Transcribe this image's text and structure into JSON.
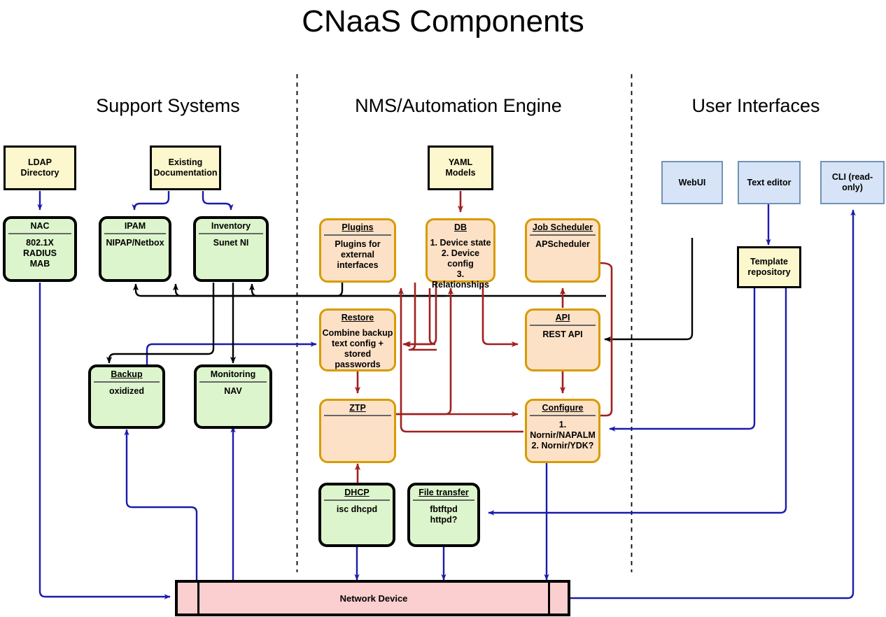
{
  "title": "CNaaS Components",
  "sections": [
    {
      "label": "Support Systems"
    },
    {
      "label": "NMS/Automation Engine"
    },
    {
      "label": "User Interfaces"
    }
  ],
  "colors": {
    "yellow_fill": "#fdf7cd",
    "green_fill": "#ddf5cc",
    "orange_fill": "#fde1c6",
    "orange_stroke": "#d79b00",
    "blue_fill": "#d7e4f7",
    "blue_stroke": "#7392b5",
    "pink_fill": "#fbcfcf",
    "arrow_blue": "#1a1aad",
    "arrow_red": "#a02020",
    "arrow_black": "#000000"
  },
  "nodes": {
    "ldap": {
      "header": "LDAP\nDirectory",
      "body": ""
    },
    "existing_docs": {
      "header": "Existing\nDocumentation",
      "body": ""
    },
    "nac": {
      "header": "NAC",
      "body": "802.1X\nRADIUS\nMAB"
    },
    "ipam": {
      "header": "IPAM",
      "body": "NIPAP/Netbox"
    },
    "inventory": {
      "header": "Inventory",
      "body": "Sunet NI"
    },
    "backup": {
      "header": "Backup",
      "body": "oxidized"
    },
    "monitoring": {
      "header": "Monitoring",
      "body": "NAV"
    },
    "yaml_models": {
      "header": "YAML\nModels",
      "body": ""
    },
    "plugins": {
      "header": "Plugins",
      "body": "Plugins for\nexternal interfaces"
    },
    "db": {
      "header": "DB",
      "body": "1. Device state\n2. Device config\n3. Relationships"
    },
    "job_scheduler": {
      "header": "Job Scheduler",
      "body": "APScheduler"
    },
    "restore": {
      "header": "Restore",
      "body": "Combine backup\ntext config +\nstored passwords"
    },
    "api": {
      "header": "API",
      "body": "REST API"
    },
    "ztp": {
      "header": "ZTP",
      "body": ""
    },
    "configure": {
      "header": "Configure",
      "body": "1. Nornir/NAPALM\n2. Nornir/YDK?"
    },
    "dhcp": {
      "header": "DHCP",
      "body": "isc dhcpd"
    },
    "file_transfer": {
      "header": "File transfer",
      "body": "fbtftpd\nhttpd?"
    },
    "webui": {
      "header": "WebUI",
      "body": ""
    },
    "text_editor": {
      "header": "Text editor",
      "body": ""
    },
    "cli": {
      "header": "CLI (read-only)",
      "body": ""
    },
    "template_repository": {
      "header": "Template\nrepository",
      "body": ""
    },
    "network_device": {
      "header": "Network Device",
      "body": ""
    }
  }
}
